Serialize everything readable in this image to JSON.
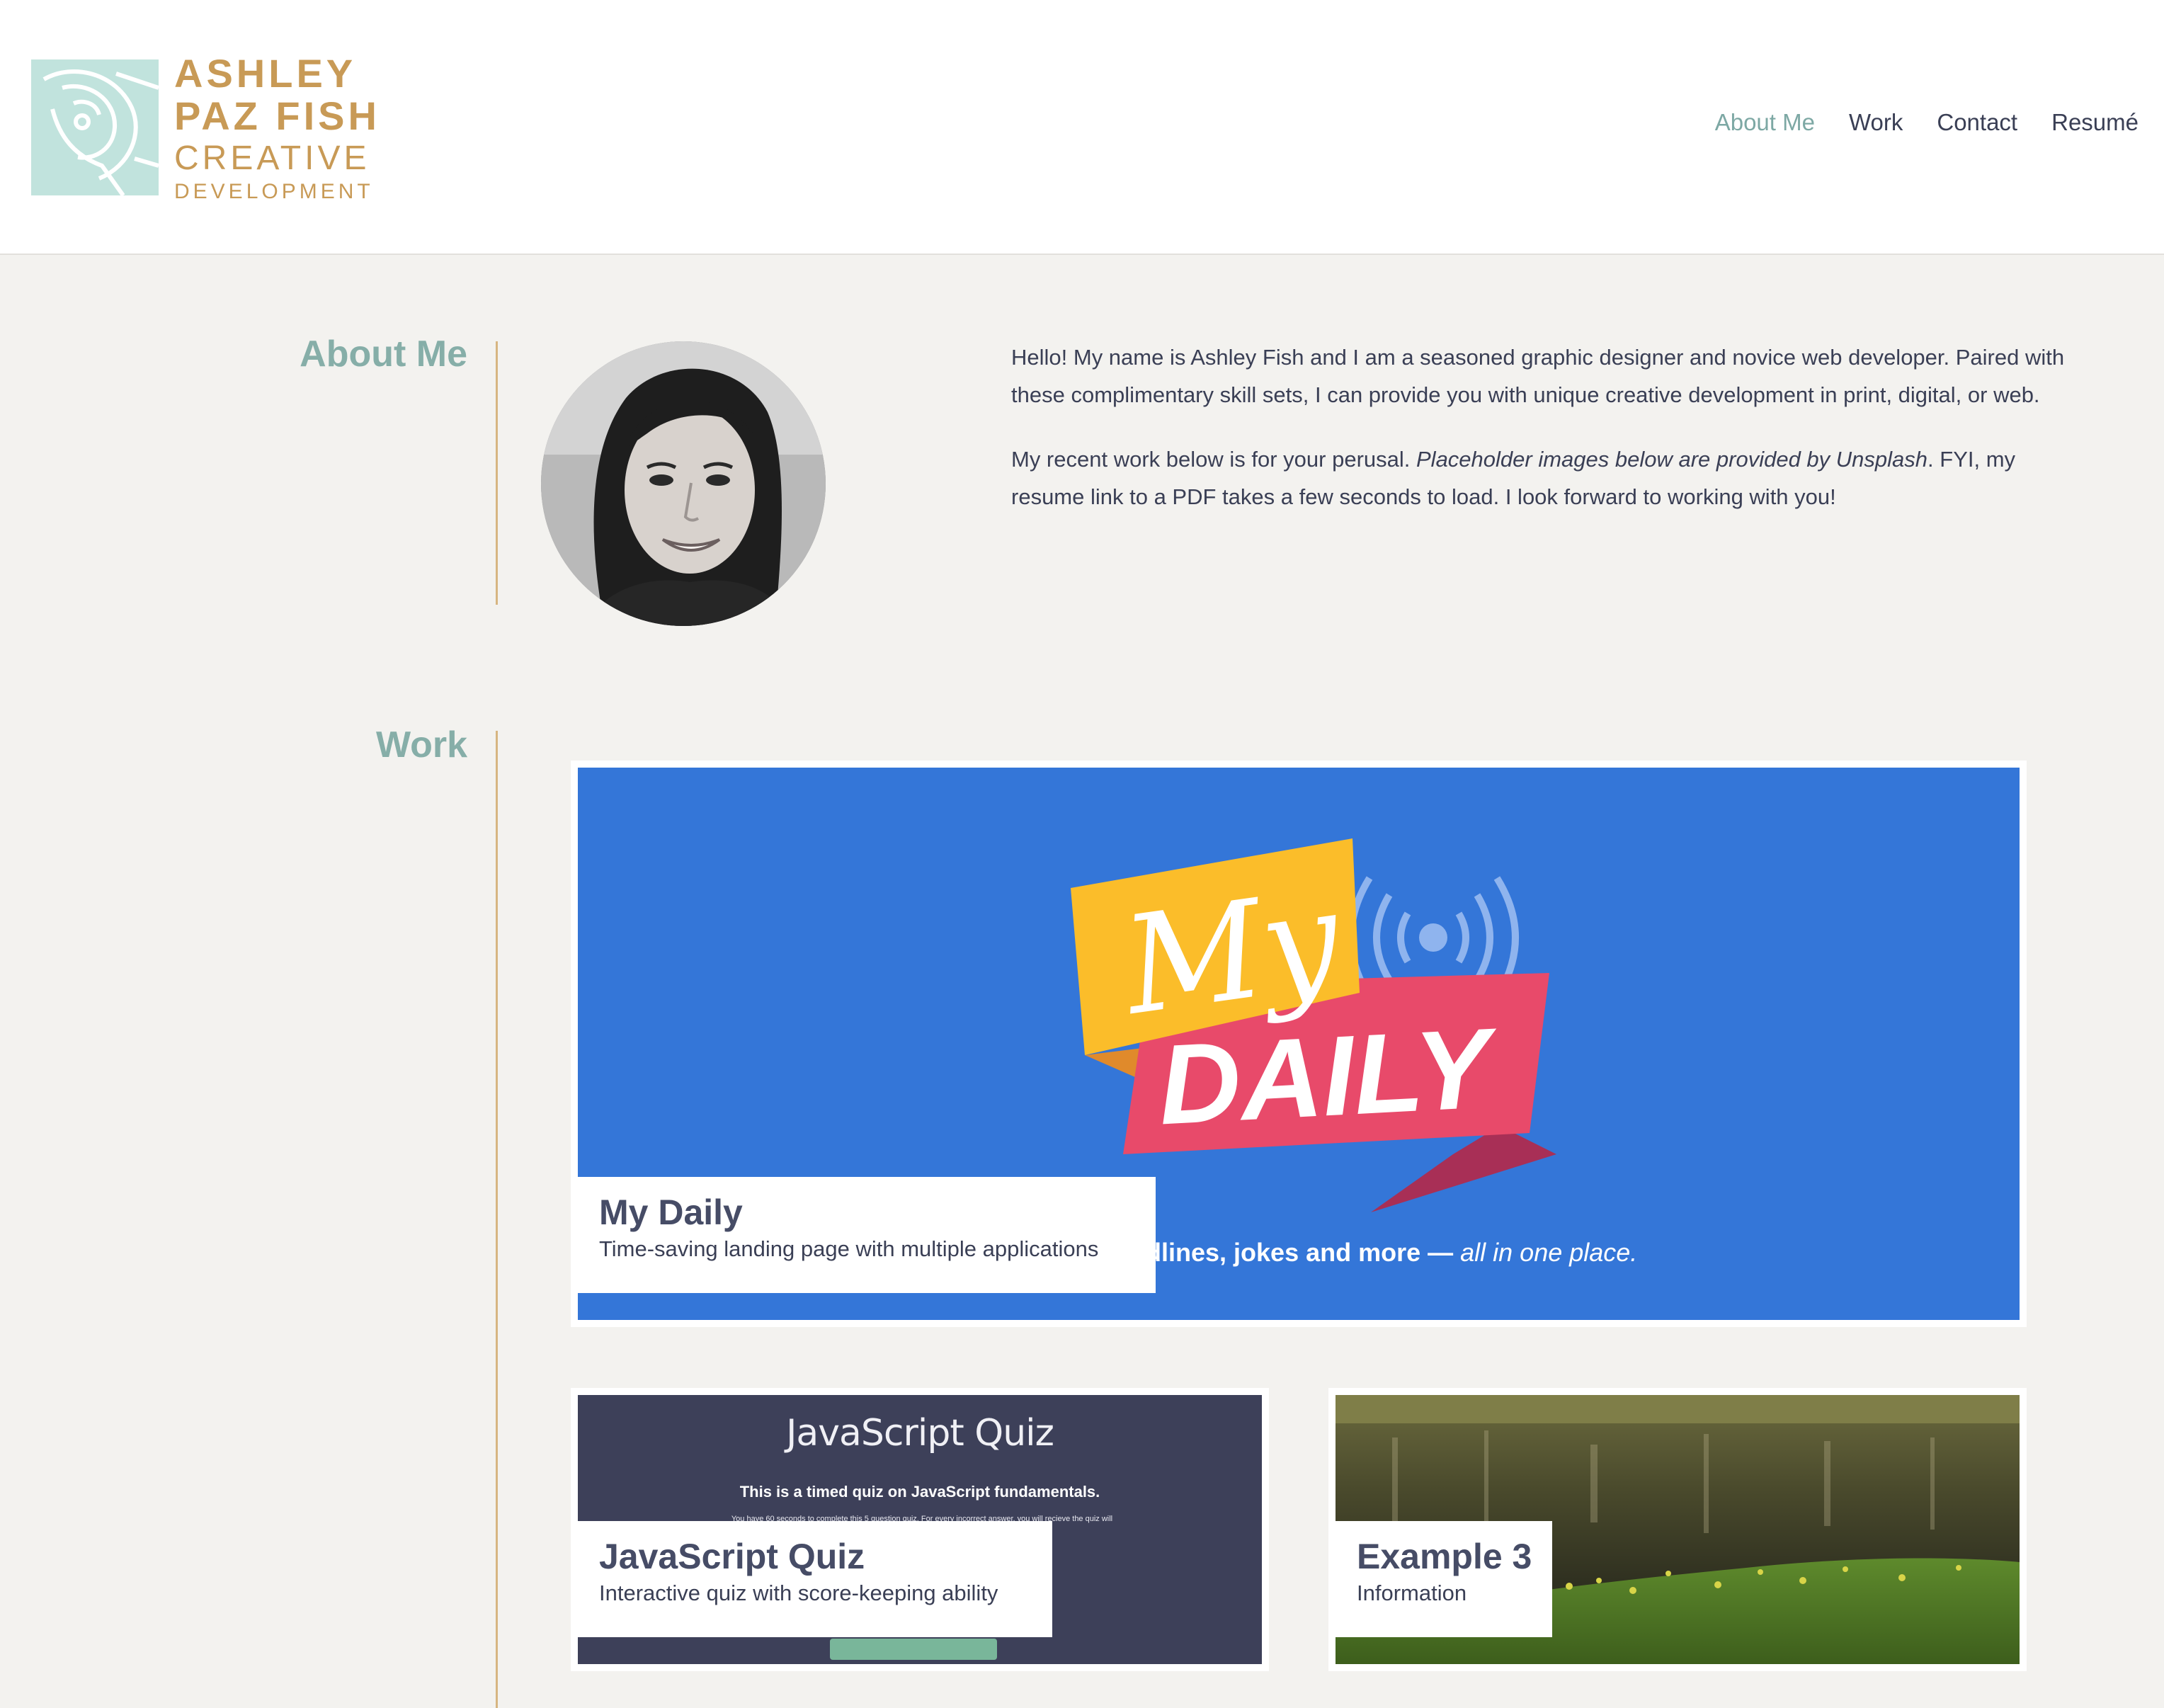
{
  "header": {
    "logo": {
      "line1": "ASHLEY",
      "line2": "PAZ FISH",
      "line3": "CREATIVE",
      "line4": "DEVELOPMENT"
    },
    "nav": [
      {
        "label": "About Me",
        "active": true
      },
      {
        "label": "Work",
        "active": false
      },
      {
        "label": "Contact",
        "active": false
      },
      {
        "label": "Resumé",
        "active": false
      }
    ]
  },
  "about": {
    "title": "About Me",
    "paragraph1": "Hello! My name is Ashley Fish and I am a seasoned graphic designer and novice web developer. Paired with these complimentary skill sets, I can provide you with unique creative development in print, digital, or web.",
    "paragraph2_start": "My recent work below is for your perusal. ",
    "paragraph2_italic": "Placeholder images below are provided by Unsplash",
    "paragraph2_end": ". FYI, my resume link to a PDF takes a few seconds to load. I look forward to working with you!"
  },
  "work": {
    "title": "Work",
    "projects": [
      {
        "title": "My Daily",
        "description": "Time-saving landing page with multiple applications",
        "image_logo_top": "My",
        "image_logo_bottom": "DAILY",
        "image_tagline": "dlines, jokes and more — ",
        "image_tagline_italic": "all in one place."
      },
      {
        "title": "JavaScript Quiz",
        "description": "Interactive quiz with score-keeping ability",
        "image_heading": "JavaScript Quiz",
        "image_subheading": "This is a timed quiz on JavaScript fundamentals.",
        "image_small_text": "You have 60 seconds to complete this 5 question quiz. For every incorrect answer, you will recieve                                                the quiz will"
      },
      {
        "title": "Example 3",
        "description": "Information"
      }
    ]
  },
  "colors": {
    "accent_gold": "#c89a56",
    "accent_teal": "#86aea8",
    "page_background": "#f3f2ef",
    "mydaily_blue": "#3476d8",
    "mydaily_yellow": "#fbbd2a",
    "mydaily_pink": "#e84a6a",
    "quiz_navy": "#3d4059"
  }
}
